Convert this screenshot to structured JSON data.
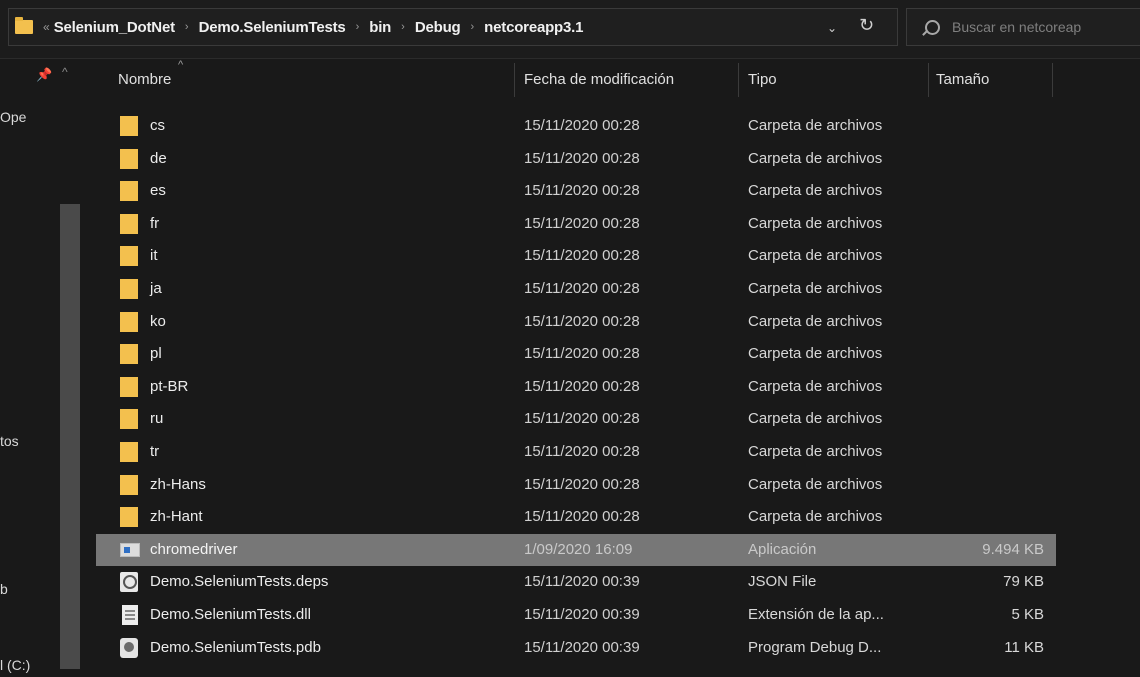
{
  "address_bar": {
    "overflow_glyph": "«",
    "crumbs": [
      "Selenium_DotNet",
      "Demo.SeleniumTests",
      "bin",
      "Debug",
      "netcoreapp3.1"
    ],
    "separator": "›",
    "dropdown_glyph": "⌄",
    "refresh_glyph": "↻"
  },
  "search": {
    "placeholder": "Buscar en netcoreap"
  },
  "nav_pane": {
    "pin_glyph": "📌",
    "up_glyph": "^",
    "labels": {
      "quick": "Ope",
      "docs": "tos",
      "blank": "b",
      "drive": "l (C:)"
    }
  },
  "columns": {
    "name": "Nombre",
    "date": "Fecha de modificación",
    "type": "Tipo",
    "size": "Tamaño",
    "sort_glyph": "^"
  },
  "files": [
    {
      "name": "cs",
      "date": "15/11/2020 00:28",
      "type": "Carpeta de archivos",
      "size": "",
      "icon": "folder-icon"
    },
    {
      "name": "de",
      "date": "15/11/2020 00:28",
      "type": "Carpeta de archivos",
      "size": "",
      "icon": "folder-icon"
    },
    {
      "name": "es",
      "date": "15/11/2020 00:28",
      "type": "Carpeta de archivos",
      "size": "",
      "icon": "folder-icon"
    },
    {
      "name": "fr",
      "date": "15/11/2020 00:28",
      "type": "Carpeta de archivos",
      "size": "",
      "icon": "folder-icon"
    },
    {
      "name": "it",
      "date": "15/11/2020 00:28",
      "type": "Carpeta de archivos",
      "size": "",
      "icon": "folder-icon"
    },
    {
      "name": "ja",
      "date": "15/11/2020 00:28",
      "type": "Carpeta de archivos",
      "size": "",
      "icon": "folder-icon"
    },
    {
      "name": "ko",
      "date": "15/11/2020 00:28",
      "type": "Carpeta de archivos",
      "size": "",
      "icon": "folder-icon"
    },
    {
      "name": "pl",
      "date": "15/11/2020 00:28",
      "type": "Carpeta de archivos",
      "size": "",
      "icon": "folder-icon"
    },
    {
      "name": "pt-BR",
      "date": "15/11/2020 00:28",
      "type": "Carpeta de archivos",
      "size": "",
      "icon": "folder-icon"
    },
    {
      "name": "ru",
      "date": "15/11/2020 00:28",
      "type": "Carpeta de archivos",
      "size": "",
      "icon": "folder-icon"
    },
    {
      "name": "tr",
      "date": "15/11/2020 00:28",
      "type": "Carpeta de archivos",
      "size": "",
      "icon": "folder-icon"
    },
    {
      "name": "zh-Hans",
      "date": "15/11/2020 00:28",
      "type": "Carpeta de archivos",
      "size": "",
      "icon": "folder-icon"
    },
    {
      "name": "zh-Hant",
      "date": "15/11/2020 00:28",
      "type": "Carpeta de archivos",
      "size": "",
      "icon": "folder-icon"
    },
    {
      "name": "chromedriver",
      "date": "1/09/2020 16:09",
      "type": "Aplicación",
      "size": "9.494 KB",
      "icon": "application-icon",
      "selected": true
    },
    {
      "name": "Demo.SeleniumTests.deps",
      "date": "15/11/2020 00:39",
      "type": "JSON File",
      "size": "79 KB",
      "icon": "json-file-icon"
    },
    {
      "name": "Demo.SeleniumTests.dll",
      "date": "15/11/2020 00:39",
      "type": "Extensión de la ap...",
      "size": "5 KB",
      "icon": "dll-file-icon"
    },
    {
      "name": "Demo.SeleniumTests.pdb",
      "date": "15/11/2020 00:39",
      "type": "Program Debug D...",
      "size": "11 KB",
      "icon": "pdb-file-icon"
    }
  ],
  "colors": {
    "background": "#191919",
    "folder": "#f3c04e",
    "selected_row": "#777777"
  }
}
